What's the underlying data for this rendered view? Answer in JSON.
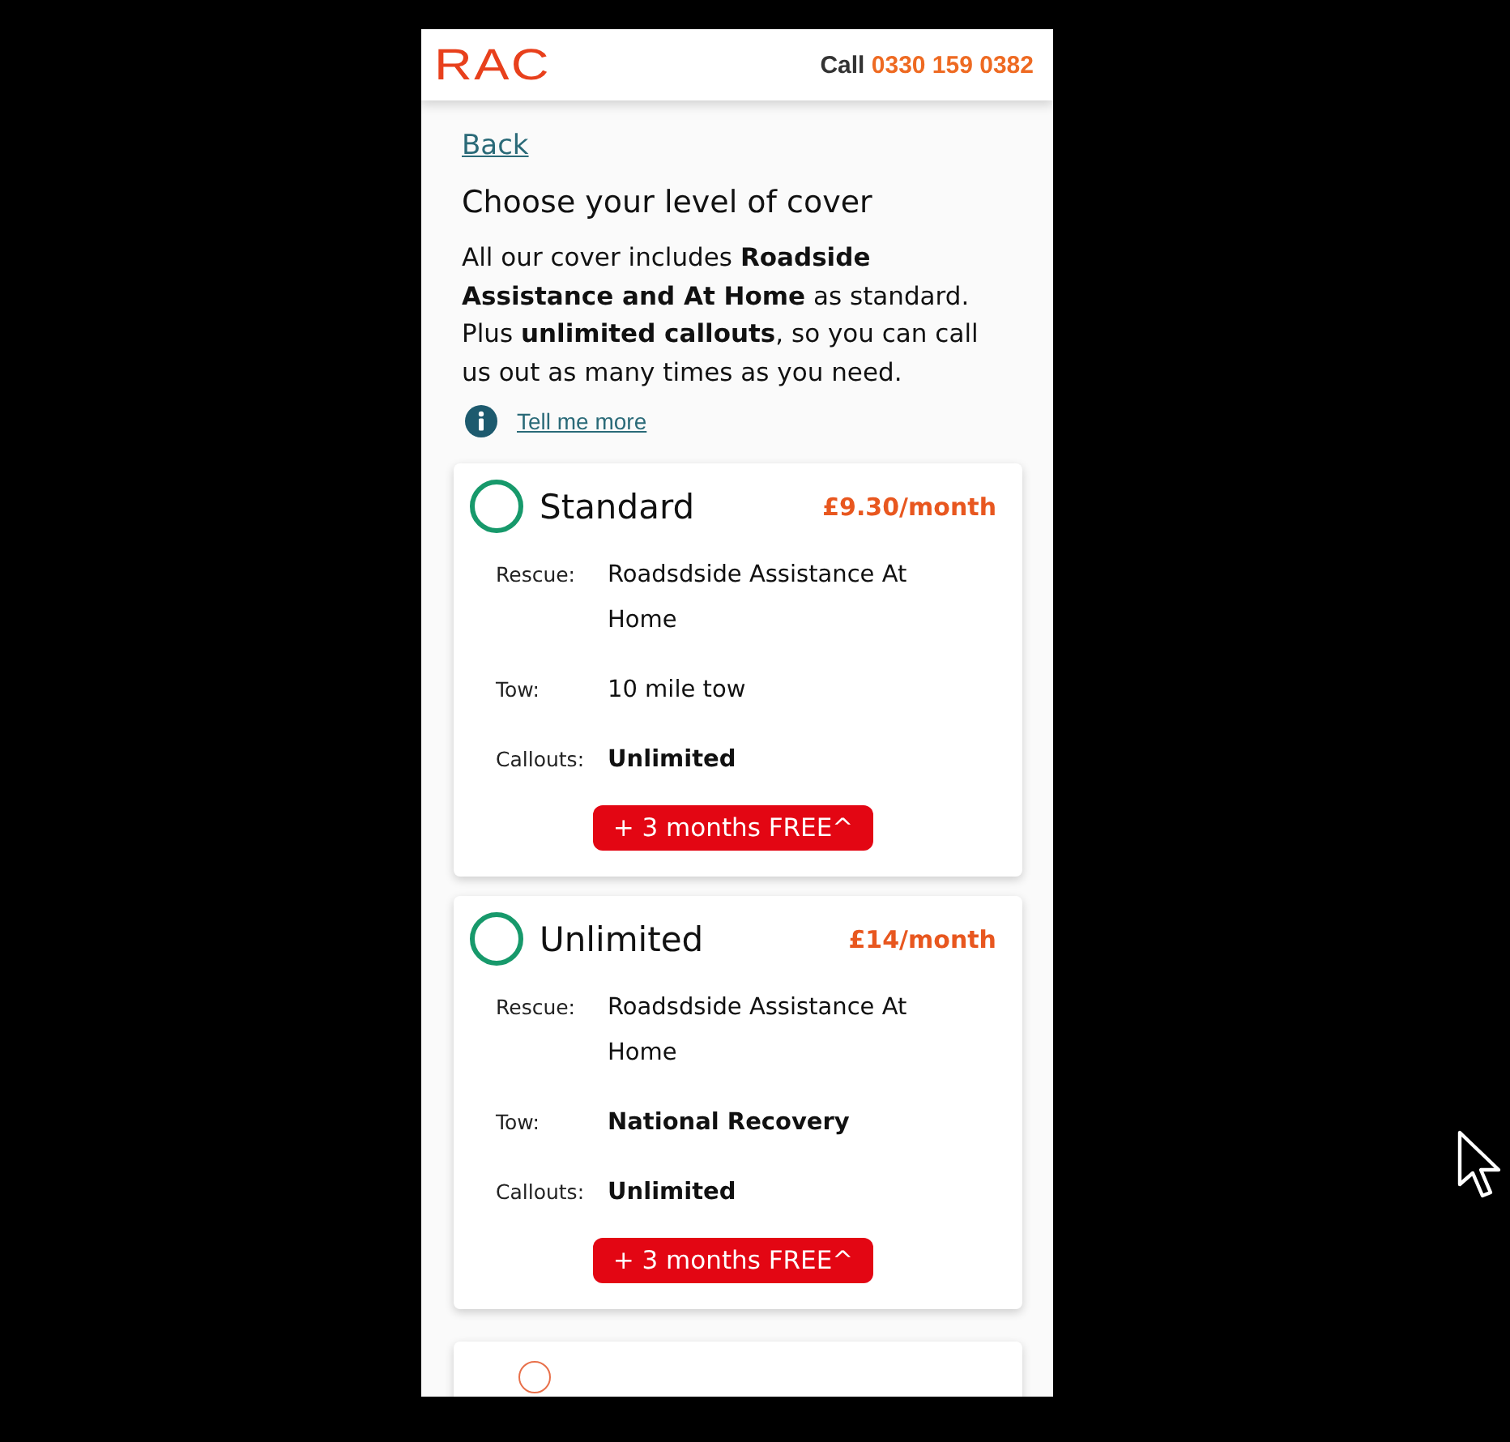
{
  "header": {
    "logo": "RAC",
    "call_label": "Call",
    "phone": "0330 159 0382"
  },
  "back_link": "Back",
  "heading": "Choose your level of cover",
  "intro": "All our cover includes **Roadside Assistance and At Home** as standard. Plus **unlimited callouts**, so you can call us out as many times as you need.",
  "info_link": "Tell me more",
  "cards": [
    {
      "kind": "plan",
      "title": "Standard",
      "price": "£9.30/month",
      "selected": false,
      "rows": [
        {
          "label": "Rescue:",
          "value": "Roadsdside Assistance At Home",
          "emphasis": false
        },
        {
          "label": "Tow:",
          "value": "10 mile tow",
          "emphasis": false
        },
        {
          "label": "Callouts:",
          "value": "Unlimited",
          "emphasis": true
        }
      ],
      "offer": "+ 3 months FREE^"
    },
    {
      "kind": "plan",
      "title": "Unlimited",
      "price": "£14/month",
      "selected": false,
      "rows": [
        {
          "label": "Rescue:",
          "value": "Roadsdside Assistance At Home",
          "emphasis": false
        },
        {
          "label": "Tow:",
          "value": "National Recovery",
          "emphasis": true
        },
        {
          "label": "Callouts:",
          "value": "Unlimited",
          "emphasis": true
        }
      ],
      "offer": "+ 3 months FREE^"
    },
    {
      "kind": "cut",
      "selected": false
    }
  ]
}
